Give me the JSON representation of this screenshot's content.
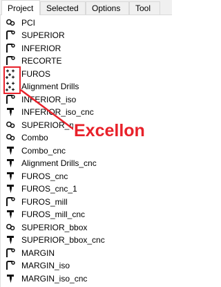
{
  "tabs": [
    {
      "label": "Project",
      "active": true
    },
    {
      "label": "Selected",
      "active": false
    },
    {
      "label": "Options",
      "active": false
    },
    {
      "label": "Tool",
      "active": false
    }
  ],
  "items": [
    {
      "label": "PCI",
      "icon": "gerber-icon"
    },
    {
      "label": "SUPERIOR",
      "icon": "geometry-icon"
    },
    {
      "label": "INFERIOR",
      "icon": "geometry-icon"
    },
    {
      "label": "RECORTE",
      "icon": "geometry-icon"
    },
    {
      "label": "FUROS",
      "icon": "excellon-icon"
    },
    {
      "label": "Alignment Drills",
      "icon": "excellon-icon"
    },
    {
      "label": "INFERIOR_iso",
      "icon": "geometry-icon"
    },
    {
      "label": "INFERIOR_iso_cnc",
      "icon": "cnc-icon"
    },
    {
      "label": "SUPERIOR_noncopper",
      "icon": "gerber-icon"
    },
    {
      "label": "Combo",
      "icon": "gerber-icon"
    },
    {
      "label": "Combo_cnc",
      "icon": "cnc-icon"
    },
    {
      "label": "Alignment Drills_cnc",
      "icon": "cnc-icon"
    },
    {
      "label": "FUROS_cnc",
      "icon": "cnc-icon"
    },
    {
      "label": "FUROS_cnc_1",
      "icon": "cnc-icon"
    },
    {
      "label": "FUROS_mill",
      "icon": "geometry-icon"
    },
    {
      "label": "FUROS_mill_cnc",
      "icon": "cnc-icon"
    },
    {
      "label": "SUPERIOR_bbox",
      "icon": "gerber-icon"
    },
    {
      "label": "SUPERIOR_bbox_cnc",
      "icon": "cnc-icon"
    },
    {
      "label": "MARGIN",
      "icon": "geometry-icon"
    },
    {
      "label": "MARGIN_iso",
      "icon": "geometry-icon"
    },
    {
      "label": "MARGIN_iso_cnc",
      "icon": "cnc-icon"
    }
  ],
  "annotation": {
    "text": "Excellon",
    "color": "#e8212a"
  }
}
